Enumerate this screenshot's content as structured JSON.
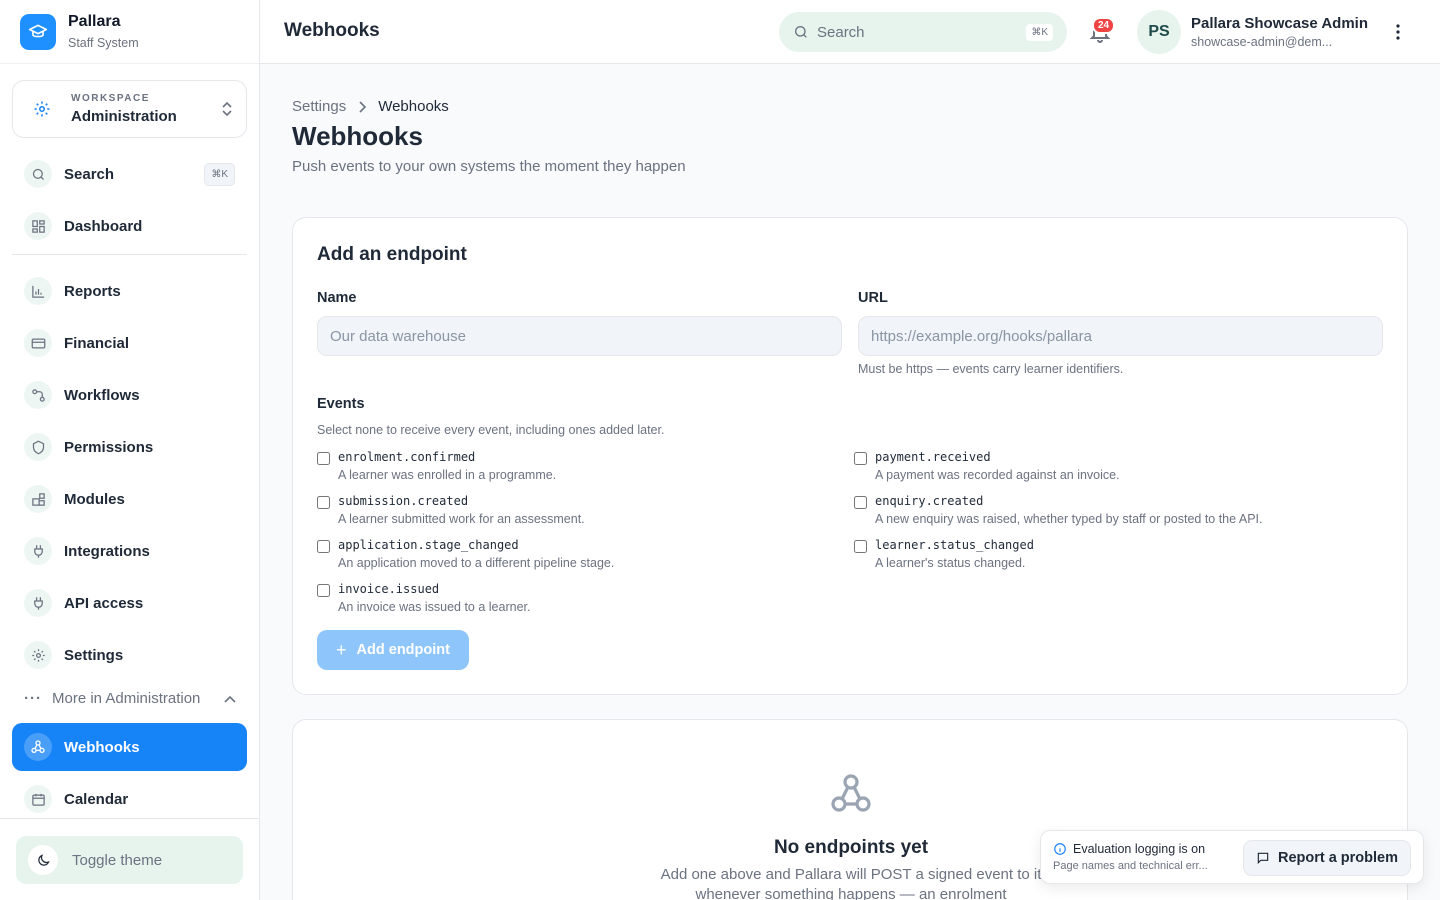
{
  "brand": {
    "name": "Pallara",
    "subtitle": "Staff System",
    "logo_icon": "graduation-cap-icon",
    "accent": "#1683f7"
  },
  "workspace": {
    "label": "WORKSPACE",
    "value": "Administration"
  },
  "nav": {
    "search": {
      "label": "Search",
      "shortcut": "⌘K"
    },
    "dashboard": "Dashboard",
    "items": [
      "Reports",
      "Financial",
      "Workflows",
      "Permissions",
      "Modules",
      "Integrations",
      "API access",
      "Settings"
    ],
    "more_label": "More in Administration",
    "webhooks": "Webhooks",
    "calendar": "Calendar",
    "toggle_theme": "Toggle theme"
  },
  "header": {
    "title": "Webhooks",
    "search_placeholder": "Search",
    "search_shortcut": "⌘K",
    "notification_count": "24",
    "user_initials": "PS",
    "user_name": "Pallara Showcase Admin",
    "user_email": "showcase-admin@dem..."
  },
  "breadcrumb": {
    "parent": "Settings",
    "current": "Webhooks"
  },
  "page": {
    "title": "Webhooks",
    "subtitle": "Push events to your own systems the moment they happen"
  },
  "form": {
    "title": "Add an endpoint",
    "name_label": "Name",
    "name_placeholder": "Our data warehouse",
    "url_label": "URL",
    "url_placeholder": "https://example.org/hooks/pallara",
    "url_hint": "Must be https — events carry learner identifiers.",
    "events_label": "Events",
    "events_hint": "Select none to receive every event, including ones added later.",
    "events": [
      {
        "name": "enrolment.confirmed",
        "desc": "A learner was enrolled in a programme."
      },
      {
        "name": "payment.received",
        "desc": "A payment was recorded against an invoice."
      },
      {
        "name": "submission.created",
        "desc": "A learner submitted work for an assessment."
      },
      {
        "name": "enquiry.created",
        "desc": "A new enquiry was raised, whether typed by staff or posted to the API."
      },
      {
        "name": "application.stage_changed",
        "desc": "An application moved to a different pipeline stage."
      },
      {
        "name": "learner.status_changed",
        "desc": "A learner's status changed."
      },
      {
        "name": "invoice.issued",
        "desc": "An invoice was issued to a learner."
      }
    ],
    "submit_label": "Add endpoint"
  },
  "empty": {
    "title": "No endpoints yet",
    "text": "Add one above and Pallara will POST a signed event to it whenever something happens — an enrolment"
  },
  "toast": {
    "title": "Evaluation logging is on",
    "subtitle": "Page names and technical err...",
    "report_label": "Report a problem"
  }
}
